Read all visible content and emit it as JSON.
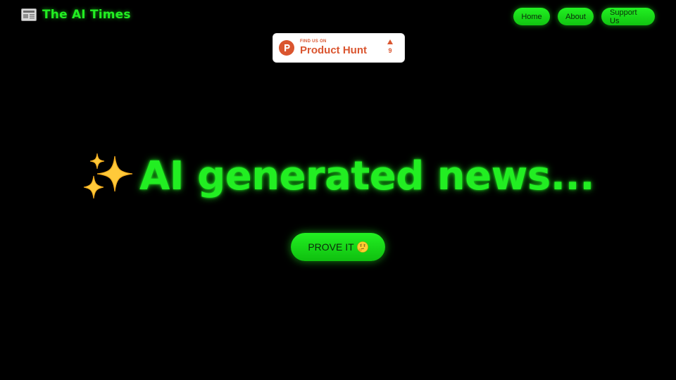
{
  "header": {
    "brand_title": "The AI Times",
    "brand_icon": "newspaper-icon",
    "nav": [
      {
        "label": "Home"
      },
      {
        "label": "About"
      },
      {
        "label": "Support Us"
      }
    ]
  },
  "product_hunt": {
    "small_text": "FIND US ON",
    "name": "Product Hunt",
    "votes": "9",
    "brand_color": "#da552f"
  },
  "hero": {
    "icon": "sparkles-icon",
    "title": "AI generated news...",
    "cta_label": "PROVE IT",
    "cta_icon": "thinking-face-icon"
  },
  "colors": {
    "background": "#000000",
    "accent": "#22ee22"
  }
}
